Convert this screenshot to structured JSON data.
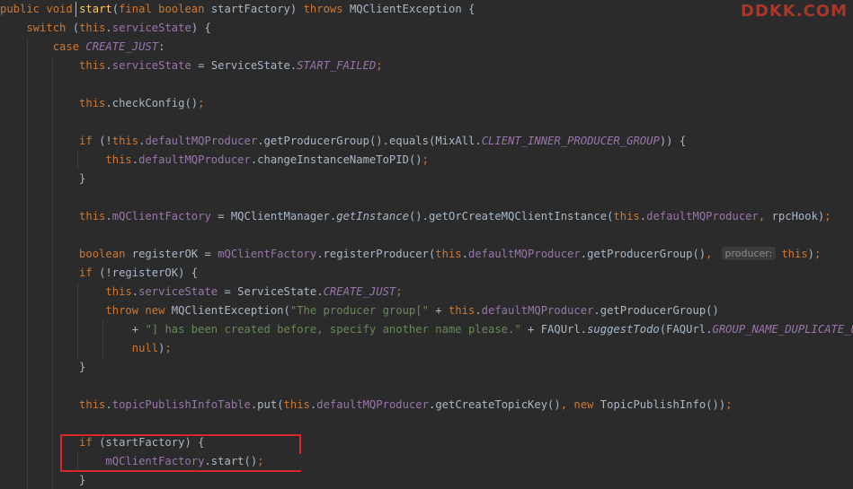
{
  "watermark": "DDKK.COM",
  "bottom_watermark": "",
  "lines": [
    [
      {
        "t": "public void ",
        "c": "kw"
      },
      {
        "t": "start",
        "c": "fn"
      },
      {
        "t": "(",
        "c": "pl"
      },
      {
        "t": "final boolean ",
        "c": "kw"
      },
      {
        "t": "startFactory) ",
        "c": "pl"
      },
      {
        "t": "throws ",
        "c": "kw"
      },
      {
        "t": "MQClientException {",
        "c": "pl"
      }
    ],
    [
      {
        "t": "    switch ",
        "c": "kw"
      },
      {
        "t": "(",
        "c": "pl"
      },
      {
        "t": "this",
        "c": "kw"
      },
      {
        "t": ".",
        "c": "pl"
      },
      {
        "t": "serviceState",
        "c": "fld"
      },
      {
        "t": ") {",
        "c": "pl"
      }
    ],
    [
      {
        "t": "        case ",
        "c": "kw"
      },
      {
        "t": "CREATE_JUST",
        "c": "cst"
      },
      {
        "t": ":",
        "c": "pl"
      }
    ],
    [
      {
        "t": "            this",
        "c": "kw"
      },
      {
        "t": ".",
        "c": "pl"
      },
      {
        "t": "serviceState",
        "c": "fld"
      },
      {
        "t": " = ServiceState.",
        "c": "pl"
      },
      {
        "t": "START_FAILED",
        "c": "cst"
      },
      {
        "t": ";",
        "c": "kw"
      }
    ],
    [],
    [
      {
        "t": "            this",
        "c": "kw"
      },
      {
        "t": ".checkConfig()",
        "c": "pl"
      },
      {
        "t": ";",
        "c": "kw"
      }
    ],
    [],
    [
      {
        "t": "            if ",
        "c": "kw"
      },
      {
        "t": "(!",
        "c": "pl"
      },
      {
        "t": "this",
        "c": "kw"
      },
      {
        "t": ".",
        "c": "pl"
      },
      {
        "t": "defaultMQProducer",
        "c": "fld"
      },
      {
        "t": ".getProducerGroup().equals(MixAll.",
        "c": "pl"
      },
      {
        "t": "CLIENT_INNER_PRODUCER_GROUP",
        "c": "cst"
      },
      {
        "t": ")) {",
        "c": "pl"
      }
    ],
    [
      {
        "t": "                this",
        "c": "kw"
      },
      {
        "t": ".",
        "c": "pl"
      },
      {
        "t": "defaultMQProducer",
        "c": "fld"
      },
      {
        "t": ".changeInstanceNameToPID()",
        "c": "pl"
      },
      {
        "t": ";",
        "c": "kw"
      }
    ],
    [
      {
        "t": "            }",
        "c": "pl"
      }
    ],
    [],
    [
      {
        "t": "            this",
        "c": "kw"
      },
      {
        "t": ".",
        "c": "pl"
      },
      {
        "t": "mQClientFactory",
        "c": "fld"
      },
      {
        "t": " = MQClientManager.",
        "c": "pl"
      },
      {
        "t": "getInstance",
        "c": "st"
      },
      {
        "t": "().getOrCreateMQClientInstance(",
        "c": "pl"
      },
      {
        "t": "this",
        "c": "kw"
      },
      {
        "t": ".",
        "c": "pl"
      },
      {
        "t": "defaultMQProducer",
        "c": "fld"
      },
      {
        "t": ", ",
        "c": "kw"
      },
      {
        "t": "rpcHook)",
        "c": "pl"
      },
      {
        "t": ";",
        "c": "kw"
      }
    ],
    [],
    [
      {
        "t": "            boolean ",
        "c": "kw"
      },
      {
        "t": "registerOK = ",
        "c": "pl"
      },
      {
        "t": "mQClientFactory",
        "c": "fld"
      },
      {
        "t": ".registerProducer(",
        "c": "pl"
      },
      {
        "t": "this",
        "c": "kw"
      },
      {
        "t": ".",
        "c": "pl"
      },
      {
        "t": "defaultMQProducer",
        "c": "fld"
      },
      {
        "t": ".getProducerGroup()",
        "c": "pl"
      },
      {
        "t": ",",
        "c": "kw"
      },
      {
        "hint": "producer:"
      },
      {
        "t": "this",
        "c": "kw"
      },
      {
        "t": ")",
        "c": "pl"
      },
      {
        "t": ";",
        "c": "kw"
      }
    ],
    [
      {
        "t": "            if ",
        "c": "kw"
      },
      {
        "t": "(!registerOK) {",
        "c": "pl"
      }
    ],
    [
      {
        "t": "                this",
        "c": "kw"
      },
      {
        "t": ".",
        "c": "pl"
      },
      {
        "t": "serviceState",
        "c": "fld"
      },
      {
        "t": " = ServiceState.",
        "c": "pl"
      },
      {
        "t": "CREATE_JUST",
        "c": "cst"
      },
      {
        "t": ";",
        "c": "kw"
      }
    ],
    [
      {
        "t": "                throw new ",
        "c": "kw"
      },
      {
        "t": "MQClientException(",
        "c": "pl"
      },
      {
        "t": "\"The producer group[\"",
        "c": "str"
      },
      {
        "t": " + ",
        "c": "pl"
      },
      {
        "t": "this",
        "c": "kw"
      },
      {
        "t": ".",
        "c": "pl"
      },
      {
        "t": "defaultMQProducer",
        "c": "fld"
      },
      {
        "t": ".getProducerGroup()",
        "c": "pl"
      }
    ],
    [
      {
        "t": "                    + ",
        "c": "pl"
      },
      {
        "t": "\"] has been created before, specify another name please.\"",
        "c": "str"
      },
      {
        "t": " + FAQUrl.",
        "c": "pl"
      },
      {
        "t": "suggestTodo",
        "c": "st"
      },
      {
        "t": "(FAQUrl.",
        "c": "pl"
      },
      {
        "t": "GROUP_NAME_DUPLICATE_URL",
        "c": "cst"
      },
      {
        "t": ")",
        "c": "pl"
      },
      {
        "t": ",",
        "c": "kw"
      }
    ],
    [
      {
        "t": "                    null",
        "c": "kw"
      },
      {
        "t": ")",
        "c": "pl"
      },
      {
        "t": ";",
        "c": "kw"
      }
    ],
    [
      {
        "t": "            }",
        "c": "pl"
      }
    ],
    [],
    [
      {
        "t": "            this",
        "c": "kw"
      },
      {
        "t": ".",
        "c": "pl"
      },
      {
        "t": "topicPublishInfoTable",
        "c": "fld"
      },
      {
        "t": ".put(",
        "c": "pl"
      },
      {
        "t": "this",
        "c": "kw"
      },
      {
        "t": ".",
        "c": "pl"
      },
      {
        "t": "defaultMQProducer",
        "c": "fld"
      },
      {
        "t": ".getCreateTopicKey()",
        "c": "pl"
      },
      {
        "t": ", new ",
        "c": "kw"
      },
      {
        "t": "TopicPublishInfo())",
        "c": "pl"
      },
      {
        "t": ";",
        "c": "kw"
      }
    ],
    [],
    [
      {
        "t": "            if ",
        "c": "kw"
      },
      {
        "t": "(startFactory) {",
        "c": "pl"
      }
    ],
    [
      {
        "t": "                mQClientFactory",
        "c": "fld"
      },
      {
        "t": ".start()",
        "c": "pl"
      },
      {
        "t": ";",
        "c": "kw"
      }
    ],
    [
      {
        "t": "            }",
        "c": "pl"
      }
    ]
  ]
}
